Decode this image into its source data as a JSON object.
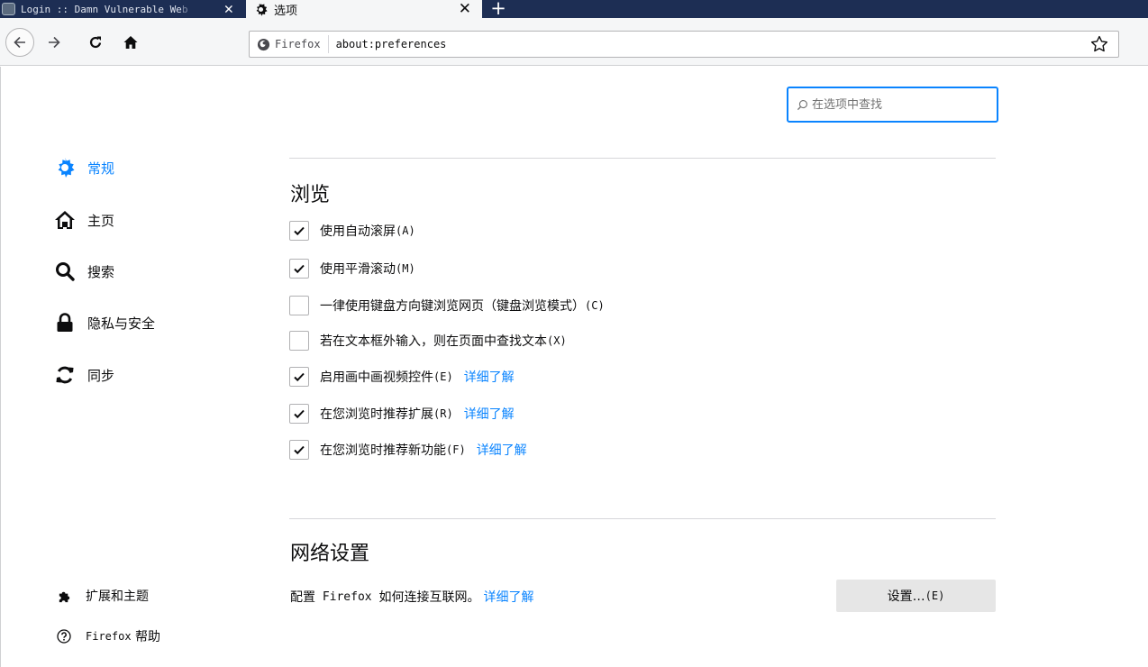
{
  "tabs": [
    {
      "title": "Login :: Damn Vulnerable We",
      "title_fade": "b",
      "close": "✕",
      "active": false
    },
    {
      "title": "选项",
      "close": "✕",
      "active": true
    }
  ],
  "newtab_label": "+",
  "nav": {
    "identity_label": "Firefox",
    "url": "about:preferences"
  },
  "search": {
    "placeholder": "在选项中查找"
  },
  "categories": [
    {
      "label": "常规",
      "icon": "gear-icon",
      "selected": true
    },
    {
      "label": "主页",
      "icon": "home-icon"
    },
    {
      "label": "搜索",
      "icon": "search-icon"
    },
    {
      "label": "隐私与安全",
      "icon": "lock-icon"
    },
    {
      "label": "同步",
      "icon": "sync-icon"
    }
  ],
  "footer_links": [
    {
      "label": "扩展和主题",
      "icon": "puzzle-icon"
    },
    {
      "label_prefix": "Firefox",
      "label": "帮助",
      "icon": "help-icon"
    }
  ],
  "browsing": {
    "title": "浏览",
    "options": [
      {
        "label": "使用自动滚屏",
        "key": "(A)",
        "checked": true
      },
      {
        "label": "使用平滑滚动",
        "key": "(M)",
        "checked": true
      },
      {
        "label": "一律使用键盘方向键浏览网页（键盘浏览模式）",
        "key": "(C)",
        "checked": false
      },
      {
        "label": "若在文本框外输入，则在页面中查找文本",
        "key": "(X)",
        "checked": false
      },
      {
        "label": "启用画中画视频控件",
        "key": "(E)",
        "checked": true,
        "learn_more": "详细了解"
      },
      {
        "label": "在您浏览时推荐扩展",
        "key": "(R)",
        "checked": true,
        "learn_more": "详细了解"
      },
      {
        "label": "在您浏览时推荐新功能",
        "key": "(F)",
        "checked": true,
        "learn_more": "详细了解"
      }
    ]
  },
  "network": {
    "title": "网络设置",
    "desc_prefix": "配置",
    "desc_brand": " Firefox ",
    "desc_suffix": "如何连接互联网。",
    "learn_more": "详细了解",
    "button_label": "设置…",
    "button_key": "(E)"
  },
  "colors": {
    "accent": "#0a84ff",
    "tabstrip": "#1d2e54",
    "toolbar": "#f5f6f7"
  }
}
